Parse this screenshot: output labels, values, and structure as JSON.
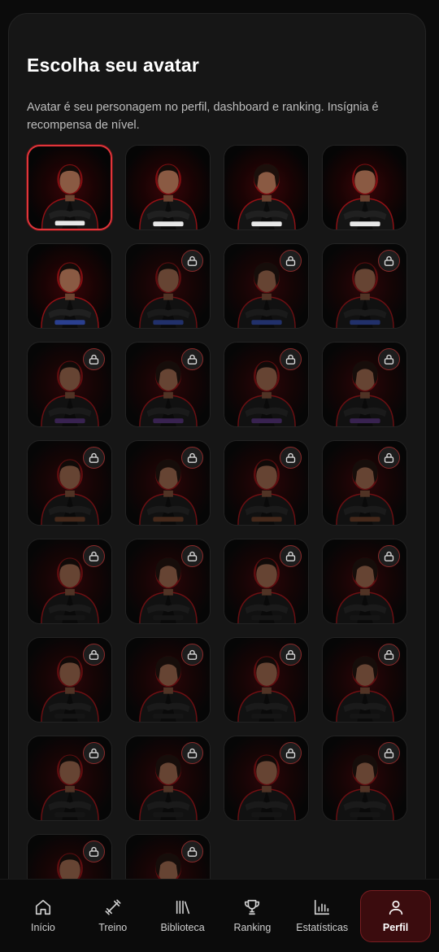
{
  "header": {
    "title": "Escolha seu avatar",
    "subtitle": "Avatar é seu personagem no perfil, dashboard e ranking. Insígnia é recompensa de nível."
  },
  "avatars": [
    {
      "locked": false,
      "selected": true,
      "belt": "white",
      "gender": "m"
    },
    {
      "locked": false,
      "selected": false,
      "belt": "white",
      "gender": "m"
    },
    {
      "locked": false,
      "selected": false,
      "belt": "white",
      "gender": "f"
    },
    {
      "locked": false,
      "selected": false,
      "belt": "white",
      "gender": "m"
    },
    {
      "locked": false,
      "selected": false,
      "belt": "blue",
      "gender": "m"
    },
    {
      "locked": true,
      "selected": false,
      "belt": "blue",
      "gender": "m"
    },
    {
      "locked": true,
      "selected": false,
      "belt": "blue",
      "gender": "f"
    },
    {
      "locked": true,
      "selected": false,
      "belt": "blue",
      "gender": "m"
    },
    {
      "locked": true,
      "selected": false,
      "belt": "purple",
      "gender": "m"
    },
    {
      "locked": true,
      "selected": false,
      "belt": "purple",
      "gender": "f"
    },
    {
      "locked": true,
      "selected": false,
      "belt": "purple",
      "gender": "m"
    },
    {
      "locked": true,
      "selected": false,
      "belt": "purple",
      "gender": "f"
    },
    {
      "locked": true,
      "selected": false,
      "belt": "brown",
      "gender": "m"
    },
    {
      "locked": true,
      "selected": false,
      "belt": "brown",
      "gender": "f"
    },
    {
      "locked": true,
      "selected": false,
      "belt": "brown",
      "gender": "m"
    },
    {
      "locked": true,
      "selected": false,
      "belt": "brown",
      "gender": "f"
    },
    {
      "locked": true,
      "selected": false,
      "belt": "black",
      "gender": "m"
    },
    {
      "locked": true,
      "selected": false,
      "belt": "black",
      "gender": "f"
    },
    {
      "locked": true,
      "selected": false,
      "belt": "black",
      "gender": "m"
    },
    {
      "locked": true,
      "selected": false,
      "belt": "black",
      "gender": "f"
    },
    {
      "locked": true,
      "selected": false,
      "belt": "black",
      "gender": "m"
    },
    {
      "locked": true,
      "selected": false,
      "belt": "black",
      "gender": "f"
    },
    {
      "locked": true,
      "selected": false,
      "belt": "black",
      "gender": "m"
    },
    {
      "locked": true,
      "selected": false,
      "belt": "black",
      "gender": "f"
    },
    {
      "locked": true,
      "selected": false,
      "belt": "black",
      "gender": "m"
    },
    {
      "locked": true,
      "selected": false,
      "belt": "black",
      "gender": "f"
    },
    {
      "locked": true,
      "selected": false,
      "belt": "black",
      "gender": "m"
    },
    {
      "locked": true,
      "selected": false,
      "belt": "black",
      "gender": "f"
    },
    {
      "locked": true,
      "selected": false,
      "belt": "black",
      "gender": "m"
    },
    {
      "locked": true,
      "selected": false,
      "belt": "black",
      "gender": "f"
    }
  ],
  "nav": {
    "items": [
      {
        "label": "Início",
        "icon": "home-icon"
      },
      {
        "label": "Treino",
        "icon": "dumbbell-icon"
      },
      {
        "label": "Biblioteca",
        "icon": "library-icon"
      },
      {
        "label": "Ranking",
        "icon": "trophy-icon"
      },
      {
        "label": "Estatísticas",
        "icon": "bar-chart-icon"
      },
      {
        "label": "Perfil",
        "icon": "user-icon"
      }
    ],
    "active_index": 5
  },
  "colors": {
    "accent": "#e0353a",
    "glow": "#c8171c",
    "belts": {
      "white": "#e8e8e8",
      "blue": "#2a3f8f",
      "purple": "#4a2b6b",
      "brown": "#5a3420",
      "black": "#1a1a1a"
    }
  }
}
